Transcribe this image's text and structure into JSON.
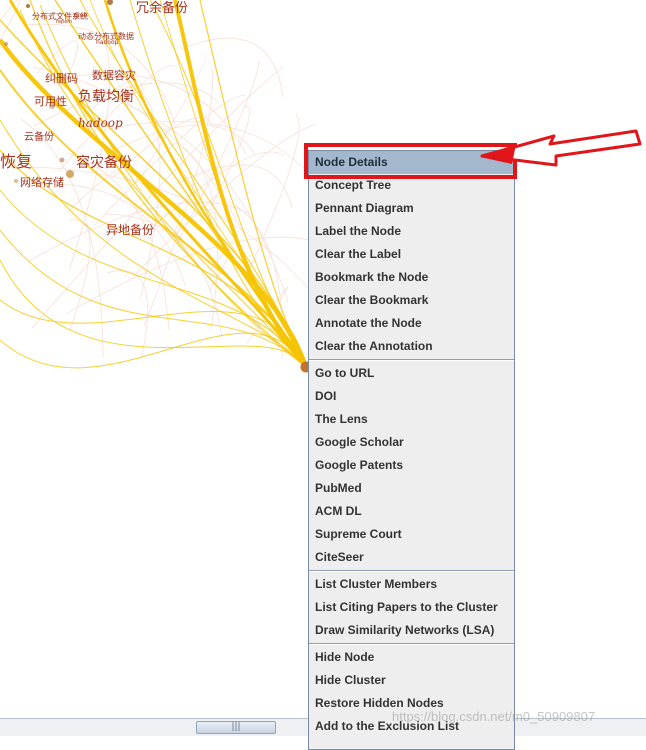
{
  "visualization": {
    "keywords": [
      {
        "text": "冗余备份"
      },
      {
        "text": "分布式文件系统"
      },
      {
        "text": "纠删码"
      },
      {
        "text": "数据容灾"
      },
      {
        "text": "负载均衡"
      },
      {
        "text": "可用性"
      },
      {
        "text": "hadoop"
      },
      {
        "text": "云备份"
      },
      {
        "text": "恢复"
      },
      {
        "text": "容灾备份"
      },
      {
        "text": "网络存储"
      },
      {
        "text": "异地备份"
      },
      {
        "text": "动态分布式数据"
      },
      {
        "text": "hadoop"
      },
      {
        "text": "gmb"
      },
      {
        "text": "repem"
      }
    ],
    "edge_color": "#f5c400",
    "node_color": "#c0732a"
  },
  "context_menu": {
    "groups": [
      [
        {
          "label": "Node Details",
          "selected": true
        },
        {
          "label": "Concept Tree"
        },
        {
          "label": "Pennant Diagram"
        },
        {
          "label": "Label the Node"
        },
        {
          "label": "Clear the Label"
        },
        {
          "label": "Bookmark the Node"
        },
        {
          "label": "Clear the Bookmark"
        },
        {
          "label": "Annotate the Node"
        },
        {
          "label": "Clear the Annotation"
        }
      ],
      [
        {
          "label": "Go to URL"
        },
        {
          "label": "DOI"
        },
        {
          "label": "The Lens"
        },
        {
          "label": "Google Scholar"
        },
        {
          "label": "Google Patents"
        },
        {
          "label": "PubMed"
        },
        {
          "label": "ACM DL"
        },
        {
          "label": "Supreme Court"
        },
        {
          "label": "CiteSeer"
        }
      ],
      [
        {
          "label": "List Cluster Members"
        },
        {
          "label": "List Citing Papers to the Cluster"
        },
        {
          "label": "Draw Similarity Networks (LSA)"
        }
      ],
      [
        {
          "label": "Hide Node"
        },
        {
          "label": "Hide Cluster"
        },
        {
          "label": "Restore Hidden Nodes"
        },
        {
          "label": "Add to the Exclusion List"
        }
      ]
    ]
  },
  "scrollbar": {
    "thumb_grip": "|||"
  },
  "watermark": "https://blog.csdn.net/m0_50909807",
  "annotation": {
    "box_color": "#e0161b"
  }
}
